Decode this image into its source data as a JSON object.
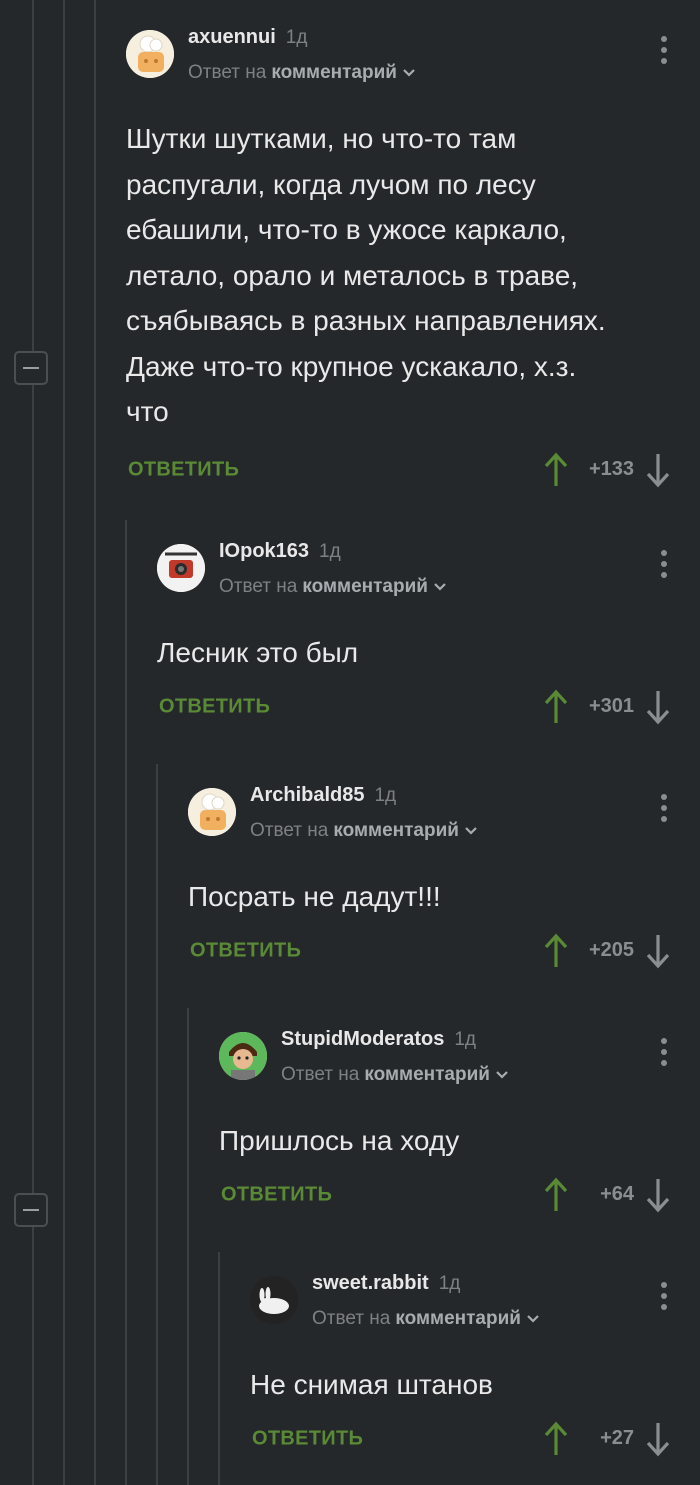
{
  "reply_to_prefix": "Ответ на",
  "reply_to_target": "комментарий",
  "reply_label": "ОТВЕТИТЬ",
  "colors": {
    "background": "#25282b",
    "accent_green": "#5a8a35",
    "thread_line": "#3c4044"
  },
  "comments": [
    {
      "author": "axuennui",
      "time": "1д",
      "avatar": "default-chef-avatar",
      "lines": [
        "Шутки шутками, но что-то там",
        "распугали, когда лучом по лесу",
        "ебашили, что-то  в ужосе каркало,",
        "летало, орало и металось в траве,",
        "съябываясь в разных направлениях.",
        "Даже что-то крупное ускакало, х.з.",
        "что"
      ],
      "score": "+133"
    },
    {
      "author": "IOpok163",
      "time": "1д",
      "avatar": "camera-avatar",
      "lines": [
        "Лесник это был"
      ],
      "score": "+301"
    },
    {
      "author": "Archibald85",
      "time": "1д",
      "avatar": "default-chef-avatar",
      "lines": [
        "Посрать не дадут!!!"
      ],
      "score": "+205"
    },
    {
      "author": "StupidModeratos",
      "time": "1д",
      "avatar": "cartoon-man-avatar",
      "lines": [
        "Пришлось на ходу"
      ],
      "score": "+64"
    },
    {
      "author": "sweet.rabbit",
      "time": "1д",
      "avatar": "rabbit-avatar",
      "lines": [
        "Не снимая штанов"
      ],
      "score": "+27"
    }
  ]
}
